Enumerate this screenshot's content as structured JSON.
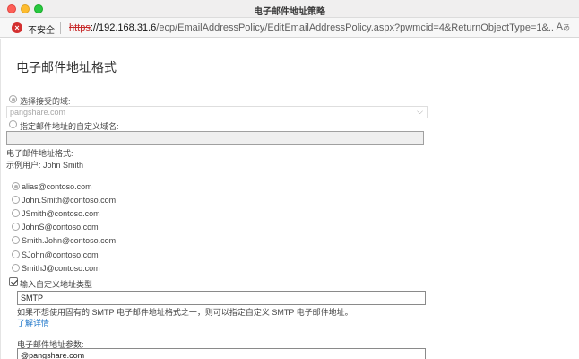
{
  "window": {
    "title": "电子邮件地址策略"
  },
  "urlbar": {
    "security_text": "不安全",
    "url_protocol": "https",
    "url_host": "://192.168.31.6",
    "url_path": "/ecp/EmailAddressPolicy/EditEmailAddressPolicy.aspx?pwmcid=4&ReturnObjectType=1&..."
  },
  "page": {
    "title": "电子邮件地址格式",
    "accepted_domain_label": "选择接受的域:",
    "accepted_domain_value": "pangshare.com",
    "custom_domain_label": "指定邮件地址的自定义域名:",
    "format_label": "电子邮件地址格式:",
    "example_user": "示例用户: John Smith",
    "formats": [
      "alias@contoso.com",
      "John.Smith@contoso.com",
      "JSmith@contoso.com",
      "JohnS@contoso.com",
      "Smith.John@contoso.com",
      "SJohn@contoso.com",
      "SmithJ@contoso.com"
    ],
    "custom_type_label": "输入自定义地址类型",
    "custom_type_value": "SMTP",
    "help_text": "如果不想使用固有的 SMTP 电子邮件地址格式之一，则可以指定自定义 SMTP 电子邮件地址。",
    "learn_more": "了解详情",
    "params_label": "电子邮件地址参数:",
    "params_value": "@pangshare.com"
  }
}
